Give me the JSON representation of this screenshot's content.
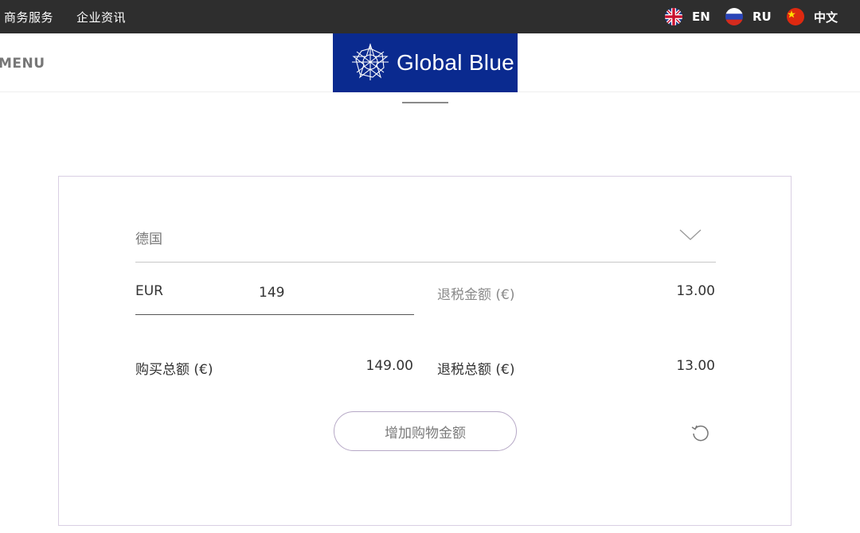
{
  "topbar": {
    "nav": [
      "商务服务",
      "企业资讯"
    ],
    "languages": [
      {
        "code": "EN",
        "flag": "uk-flag-icon"
      },
      {
        "code": "RU",
        "flag": "russia-flag-icon"
      },
      {
        "code": "中文",
        "flag": "china-flag-icon"
      }
    ]
  },
  "header": {
    "menu_label": "MENU",
    "logo_text": "Global Blue",
    "brand_color": "#0a2a8f"
  },
  "calculator": {
    "country": "德国",
    "currency": "EUR",
    "amount": "149",
    "refund_label": "退税金额 (€)",
    "refund_value": "13.00",
    "total_purchase_label": "购买总额 (€)",
    "total_purchase_value": "149.00",
    "total_refund_label": "退税总额 (€)",
    "total_refund_value": "13.00",
    "add_button": "增加购物金额",
    "reset_icon": "reset-icon"
  }
}
